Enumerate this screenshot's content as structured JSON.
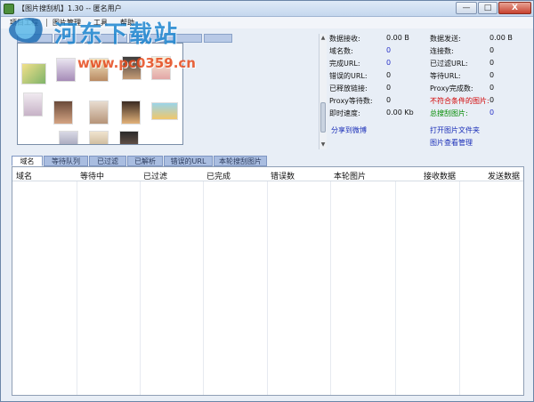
{
  "window": {
    "title": "【图片搜刮机】1.30 -- 匿名用户",
    "minimize_label": "—",
    "maximize_label": "□",
    "close_label": "X"
  },
  "menu": {
    "items": [
      "项目工程",
      "图片管理",
      "工具",
      "帮助"
    ]
  },
  "watermark": {
    "main": "河东下载站",
    "url": "www.pc0359.cn"
  },
  "stats": {
    "left": [
      {
        "label": "数据接收:",
        "value": "0.00 B"
      },
      {
        "label": "域名数:",
        "value": "0"
      },
      {
        "label": "完成URL:",
        "value": "0"
      },
      {
        "label": "错误的URL:",
        "value": "0"
      },
      {
        "label": "已释放链接:",
        "value": "0"
      },
      {
        "label": "Proxy等待数:",
        "value": "0"
      },
      {
        "label": "即时速度:",
        "value": "0.00 Kb"
      }
    ],
    "right": [
      {
        "label": "数据发送:",
        "value": "0.00 B"
      },
      {
        "label": "连接数:",
        "value": "0"
      },
      {
        "label": "已过滤URL:",
        "value": "0"
      },
      {
        "label": "等待URL:",
        "value": "0"
      },
      {
        "label": "Proxy完成数:",
        "value": "0"
      },
      {
        "label": "不符合条件的图片:",
        "value": "0"
      },
      {
        "label": "总搜刮图片:",
        "value": "0"
      }
    ],
    "links": {
      "share": "分享到微博",
      "open_folder": "打开图片文件夹",
      "image_manager": "图片查看管理"
    }
  },
  "tabs": [
    "域名",
    "等待队列",
    "已过滤",
    "已解析",
    "错误的URL",
    "本轮搜刮图片"
  ],
  "grid": {
    "columns": [
      "域名",
      "等待中",
      "已过滤",
      "已完成",
      "错误数",
      "本轮图片",
      "接收数据",
      "发送数据"
    ]
  },
  "colors": {
    "accent": "#1b2fb8",
    "value_blue": "#2a33c8",
    "warning_red": "#d20000",
    "total_green": "#008a00",
    "tab_blue": "#a9bde0"
  }
}
